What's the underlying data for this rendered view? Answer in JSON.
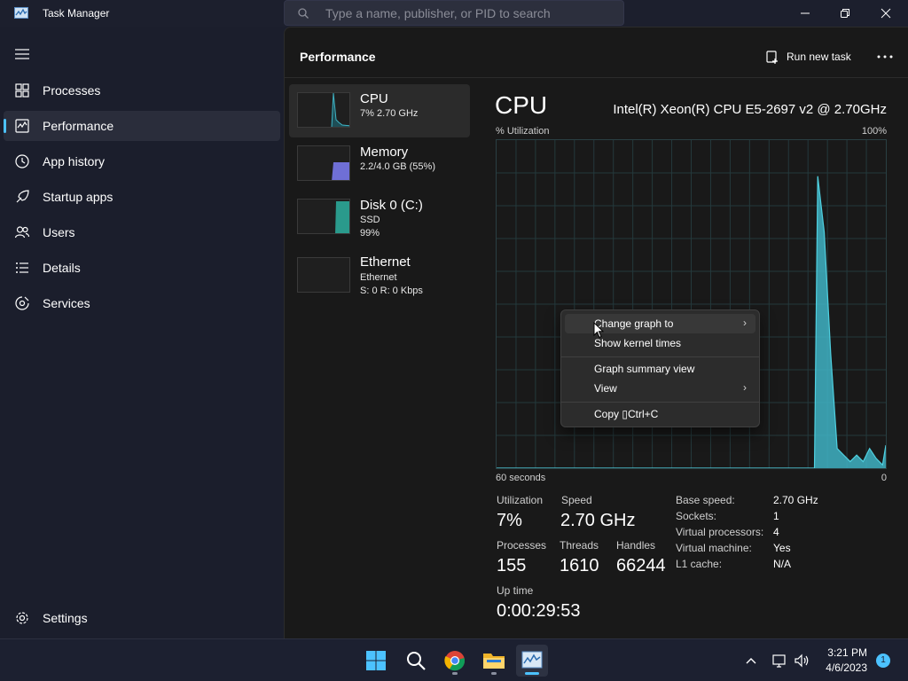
{
  "app": {
    "title": "Task Manager",
    "search_placeholder": "Type a name, publisher, or PID to search"
  },
  "sidebar": {
    "items": [
      {
        "label": "Processes",
        "icon": "processes-icon"
      },
      {
        "label": "Performance",
        "icon": "performance-icon",
        "active": true
      },
      {
        "label": "App history",
        "icon": "history-icon"
      },
      {
        "label": "Startup apps",
        "icon": "startup-icon"
      },
      {
        "label": "Users",
        "icon": "users-icon"
      },
      {
        "label": "Details",
        "icon": "details-icon"
      },
      {
        "label": "Services",
        "icon": "services-icon"
      }
    ],
    "settings_label": "Settings"
  },
  "header": {
    "title": "Performance",
    "run_task_label": "Run new task"
  },
  "resources": [
    {
      "name": "CPU",
      "sub1": "7%  2.70 GHz",
      "sub2": "",
      "color": "#3fb3c4"
    },
    {
      "name": "Memory",
      "sub1": "2.2/4.0 GB (55%)",
      "sub2": "",
      "color": "#7f7fe0"
    },
    {
      "name": "Disk 0 (C:)",
      "sub1": "SSD",
      "sub2": "99%",
      "color": "#2fa99a"
    },
    {
      "name": "Ethernet",
      "sub1": "Ethernet",
      "sub2": "S: 0  R: 0 Kbps",
      "color": "#c86a76"
    }
  ],
  "detail": {
    "title": "CPU",
    "model": "Intel(R) Xeon(R) CPU E5-2697 v2 @ 2.70GHz",
    "util_label": "% Utilization",
    "util_max": "100%",
    "x_left": "60 seconds",
    "x_right": "0",
    "stats": {
      "utilization_label": "Utilization",
      "utilization": "7%",
      "speed_label": "Speed",
      "speed": "2.70 GHz",
      "processes_label": "Processes",
      "processes": "155",
      "threads_label": "Threads",
      "threads": "1610",
      "handles_label": "Handles",
      "handles": "66244",
      "uptime_label": "Up time",
      "uptime": "0:00:29:53"
    },
    "specs": [
      {
        "k": "Base speed:",
        "v": "2.70 GHz"
      },
      {
        "k": "Sockets:",
        "v": "1"
      },
      {
        "k": "Virtual processors:",
        "v": "4"
      },
      {
        "k": "Virtual machine:",
        "v": "Yes"
      },
      {
        "k": "L1 cache:",
        "v": "N/A"
      }
    ]
  },
  "context_menu": {
    "items": [
      "Change graph to",
      "Show kernel times",
      "Graph summary view",
      "View",
      "Copy \u0000Ctrl+C"
    ],
    "copy_display": "Copy ▯Ctrl+C"
  },
  "taskbar": {
    "apps": [
      "start-icon",
      "search-icon",
      "chrome-icon",
      "file-explorer-icon",
      "task-manager-icon"
    ],
    "time": "3:21 PM",
    "date": "4/6/2023",
    "notifications": "1"
  },
  "colors": {
    "accent": "#4cc2ff",
    "cpu_graph": "#3fb3c4",
    "grid": "#24393c"
  },
  "chart_data": {
    "type": "area",
    "title": "CPU",
    "ylabel": "% Utilization",
    "ylim": [
      0,
      100
    ],
    "x": [
      60,
      57,
      54,
      51,
      48,
      45,
      42,
      39,
      36,
      33,
      30,
      27,
      24,
      23.5,
      22,
      19.5,
      18,
      16.5,
      15,
      14,
      13,
      12,
      11,
      10.5,
      9.5,
      8.5,
      7.5,
      6.5,
      5.5,
      4.5,
      3.5,
      2.5,
      1.5,
      0.5,
      0
    ],
    "values": [
      0,
      0,
      0,
      0,
      0,
      0,
      0,
      0,
      0,
      0,
      0,
      0,
      0,
      0,
      0,
      0,
      0,
      0,
      0,
      0,
      0,
      0,
      0,
      89,
      72,
      35,
      6,
      4,
      2,
      4,
      2,
      6,
      3,
      1,
      7
    ]
  }
}
